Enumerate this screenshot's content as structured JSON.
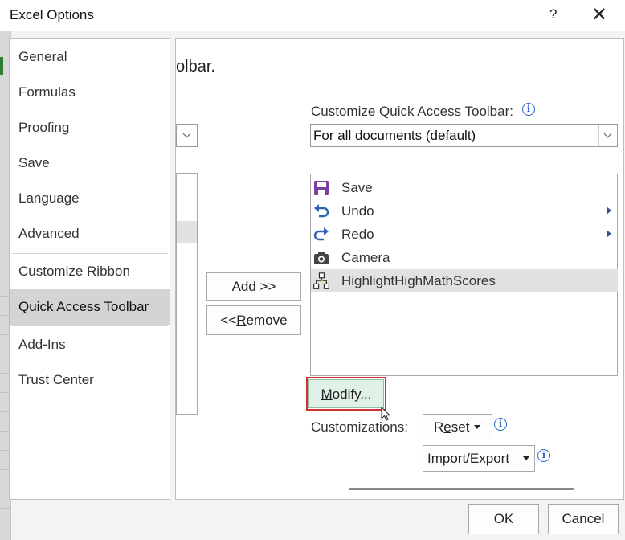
{
  "window": {
    "title": "Excel Options",
    "help_glyph": "?",
    "close_glyph": "✕"
  },
  "nav": {
    "items": [
      {
        "label": "General"
      },
      {
        "label": "Formulas"
      },
      {
        "label": "Proofing"
      },
      {
        "label": "Save"
      },
      {
        "label": "Language"
      },
      {
        "label": "Advanced"
      },
      {
        "label": "Customize Ribbon"
      },
      {
        "label": "Quick Access Toolbar",
        "selected": true
      },
      {
        "label": "Add-Ins"
      },
      {
        "label": "Trust Center"
      }
    ]
  },
  "main": {
    "heading_fragment": "olbar.",
    "customize_label": {
      "pre": "Customize ",
      "accel": "Q",
      "post": "uick Access Toolbar:"
    },
    "scope_select": {
      "value": "For all documents (default)"
    },
    "toolbar_items": [
      {
        "label": "Save",
        "icon": "save-icon"
      },
      {
        "label": "Undo",
        "icon": "undo-icon",
        "has_submenu": true
      },
      {
        "label": "Redo",
        "icon": "redo-icon",
        "has_submenu": true
      },
      {
        "label": "Camera",
        "icon": "camera-icon"
      },
      {
        "label": "HighlightHighMathScores",
        "icon": "macro-icon",
        "selected": true
      }
    ],
    "add_button": {
      "accel": "A",
      "rest": "dd >>"
    },
    "remove_button": {
      "pre": "<< ",
      "accel": "R",
      "rest": "emove"
    },
    "modify_button": {
      "accel": "M",
      "rest": "odify..."
    },
    "customizations_label": "Customizations:",
    "reset_button": {
      "pre": "R",
      "accel": "e",
      "rest": "set"
    },
    "import_export_button": {
      "pre": "Import/Ex",
      "accel": "p",
      "rest": "ort"
    },
    "info_glyph": "i"
  },
  "footer": {
    "ok": "OK",
    "cancel": "Cancel"
  },
  "colors": {
    "modify_highlight": "#d32f2f",
    "modify_fill": "#dff1e6",
    "info_blue": "#2b66c4",
    "save_icon": "#7b3fa0",
    "undo_redo_icon": "#2e63b0"
  }
}
